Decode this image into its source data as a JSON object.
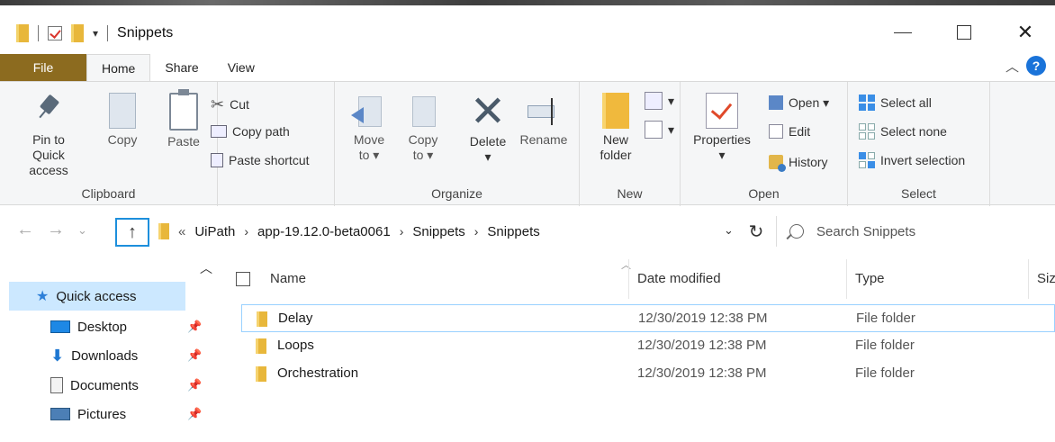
{
  "window": {
    "title": "Snippets",
    "qat_dropdown_glyph": "▾"
  },
  "ribbon_tabs": [
    "File",
    "Home",
    "Share",
    "View"
  ],
  "clipboard": {
    "group": "Clipboard",
    "pin_label_1": "Pin to Quick",
    "pin_label_2": "access",
    "copy": "Copy",
    "paste": "Paste",
    "cut": "Cut",
    "copy_path": "Copy path",
    "paste_shortcut": "Paste shortcut"
  },
  "organize": {
    "group": "Organize",
    "move_1": "Move",
    "move_2": "to ▾",
    "copy_1": "Copy",
    "copy_2": "to ▾",
    "delete": "Delete",
    "delete_drop": "▾",
    "rename": "Rename"
  },
  "new": {
    "group": "New",
    "folder_1": "New",
    "folder_2": "folder"
  },
  "open": {
    "group": "Open",
    "properties": "Properties",
    "properties_drop": "▾",
    "open": "Open ▾",
    "edit": "Edit",
    "history": "History"
  },
  "select": {
    "group": "Select",
    "all": "Select all",
    "none": "Select none",
    "invert": "Invert selection"
  },
  "address": {
    "overflow": "«",
    "crumbs": [
      "UiPath",
      "app-19.12.0-beta0061",
      "Snippets",
      "Snippets"
    ],
    "search_placeholder": "Search Snippets"
  },
  "nav": {
    "quick_access": "Quick access",
    "items": [
      "Desktop",
      "Downloads",
      "Documents",
      "Pictures"
    ]
  },
  "columns": {
    "name": "Name",
    "date": "Date modified",
    "type": "Type",
    "size": "Siz"
  },
  "files": [
    {
      "name": "Delay",
      "date": "12/30/2019 12:38 PM",
      "type": "File folder"
    },
    {
      "name": "Loops",
      "date": "12/30/2019 12:38 PM",
      "type": "File folder"
    },
    {
      "name": "Orchestration",
      "date": "12/30/2019 12:38 PM",
      "type": "File folder"
    }
  ],
  "colors": {
    "file_tab": "#8c6b1f",
    "selection": "#cce8ff",
    "accent": "#1d8fdc",
    "folder": "#e8b73b"
  }
}
